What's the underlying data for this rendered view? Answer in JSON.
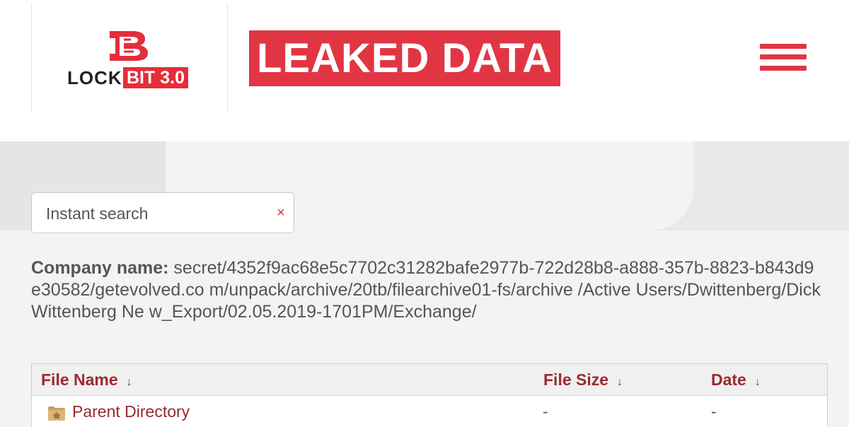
{
  "header": {
    "logo": {
      "brand_left": "LOCK",
      "brand_right": "BIT 3.0",
      "mark_icon": "lockbit-lb-logo-icon"
    },
    "banner_title": "LEAKED DATA",
    "menu_icon": "hamburger-menu-icon"
  },
  "search": {
    "placeholder": "Instant search",
    "clear_symbol": "×"
  },
  "company": {
    "label": "Company name:",
    "value": " secret/4352f9ac68e5c7702c31282bafe2977b-722d28b8-a888-357b-8823-b843d9e30582/getevolved.co m/unpack/archive/20tb/filearchive01-fs/archive /Active Users/Dwittenberg/Dick Wittenberg Ne w_Export/02.05.2019-1701PM/Exchange/"
  },
  "table": {
    "columns": [
      {
        "label": "File Name",
        "sort_symbol": "↓"
      },
      {
        "label": "File Size",
        "sort_symbol": "↓"
      },
      {
        "label": "Date",
        "sort_symbol": "↓"
      }
    ],
    "rows": [
      {
        "name": "Parent Directory",
        "icon": "folder-icon",
        "size": "-",
        "date": "-"
      }
    ]
  },
  "colors": {
    "accent_red": "#e23543",
    "link_red": "#9b2a30",
    "text_gray": "#555555",
    "background": "#f3f3f3"
  }
}
